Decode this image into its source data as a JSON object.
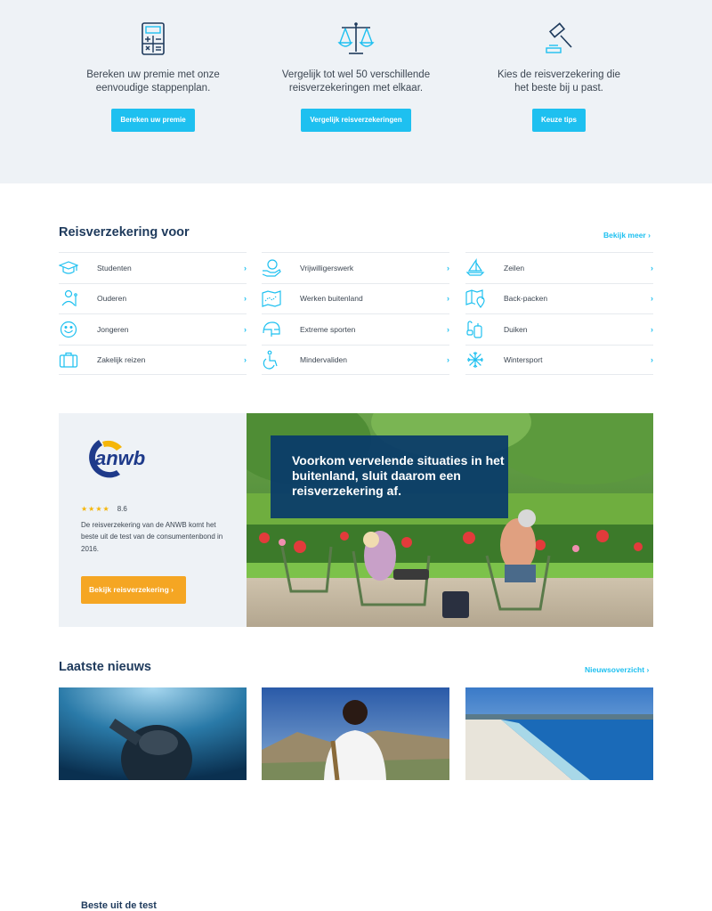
{
  "steps": [
    {
      "icon": "calculator-icon",
      "text_line1": "Bereken uw premie met onze",
      "text_line2": "eenvoudige stappenplan.",
      "button": "Bereken uw premie"
    },
    {
      "icon": "scales-icon",
      "text_line1": "Vergelijk tot wel 50 verschillende",
      "text_line2": "reisverzekeringen met elkaar.",
      "button": "Vergelijk reisverzekeringen"
    },
    {
      "icon": "gavel-icon",
      "text_line1": "Kies de reisverzekering die",
      "text_line2": "het beste bij u past.",
      "button": "Keuze tips"
    }
  ],
  "categories": {
    "title": "Reisverzekering voor",
    "more_link": "Bekijk meer",
    "columns": [
      [
        {
          "label": "Studenten",
          "icon": "graduation-cap-icon"
        },
        {
          "label": "Ouderen",
          "icon": "elderly-icon"
        },
        {
          "label": "Jongeren",
          "icon": "smiley-icon"
        },
        {
          "label": "Zakelijk reizen",
          "icon": "suitcase-icon"
        }
      ],
      [
        {
          "label": "Vrijwilligerswerk",
          "icon": "helping-hand-icon"
        },
        {
          "label": "Werken buitenland",
          "icon": "world-map-icon"
        },
        {
          "label": "Extreme sporten",
          "icon": "helmet-icon"
        },
        {
          "label": "Mindervaliden",
          "icon": "wheelchair-icon"
        }
      ],
      [
        {
          "label": "Zeilen",
          "icon": "sailboat-icon"
        },
        {
          "label": "Back-packen",
          "icon": "map-pin-icon"
        },
        {
          "label": "Duiken",
          "icon": "diving-icon"
        },
        {
          "label": "Wintersport",
          "icon": "snowflake-icon"
        }
      ]
    ]
  },
  "promo": {
    "logo_text": "anwb",
    "title": "Beste uit de test",
    "stars": "★★★★",
    "score": "8.6",
    "description": "De reisverzekering van de ANWB komt het beste uit de test van de consumentenbond in 2016.",
    "button": "Bekijk reisverzekering",
    "headline": "Voorkom vervelende situaties in het buitenland, sluit daarom een reisverzekering af."
  },
  "news": {
    "title": "Laatste nieuws",
    "more_link": "Nieuwsoverzicht"
  },
  "colors": {
    "accent": "#1ec0f0",
    "navy": "#1e3a5c",
    "orange": "#f5a623",
    "light_bg": "#eef2f6"
  }
}
